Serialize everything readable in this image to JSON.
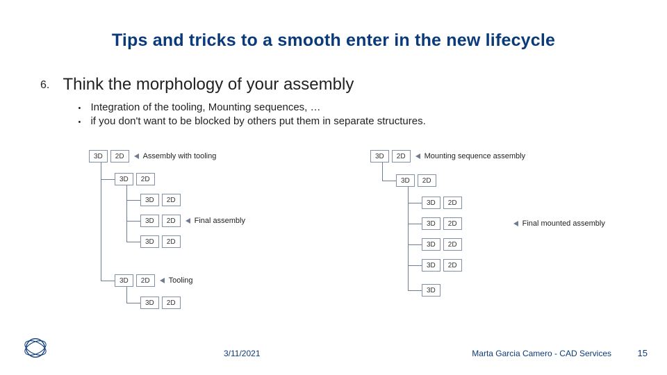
{
  "title": "Tips and tricks to a smooth enter in the new lifecycle",
  "item": {
    "number": "6.",
    "heading": "Think the morphology of your assembly",
    "bullets": [
      "Integration of the tooling, Mounting sequences, …",
      "if you don't want to be blocked by others put them in separate structures."
    ]
  },
  "labels": {
    "b3d": "3D",
    "b2d": "2D",
    "left_top": "Assembly with tooling",
    "left_mid": "Final assembly",
    "left_bot": "Tooling",
    "right_top": "Mounting sequence assembly",
    "right_mid": "Final mounted assembly"
  },
  "footer": {
    "date": "3/11/2021",
    "author": "Marta Garcia Camero - CAD Services",
    "page": "15"
  }
}
